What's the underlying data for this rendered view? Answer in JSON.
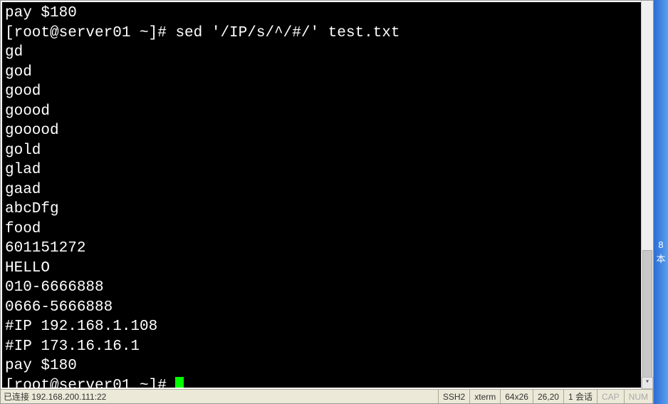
{
  "terminal": {
    "lines": [
      "pay $180",
      "[root@server01 ~]# sed '/IP/s/^/#/' test.txt",
      "gd",
      "god",
      "good",
      "goood",
      "gooood",
      "gold",
      "glad",
      "gaad",
      "abcDfg",
      "food",
      "601151272",
      "HELLO",
      "010-6666888",
      "0666-5666888",
      "#IP 192.168.1.108",
      "#IP 173.16.16.1",
      "pay $180"
    ],
    "prompt": "[root@server01 ~]# "
  },
  "status": {
    "connection": "已连接 192.168.200.111:22",
    "protocol": "SSH2",
    "term": "xterm",
    "size": "64x26",
    "pos": "26,20",
    "sessions": "1 会话",
    "cap": "CAP",
    "num": "NUM"
  },
  "sidebar": {
    "char1": "8",
    "char2": "本"
  },
  "scroll": {
    "arrow": "▾"
  }
}
